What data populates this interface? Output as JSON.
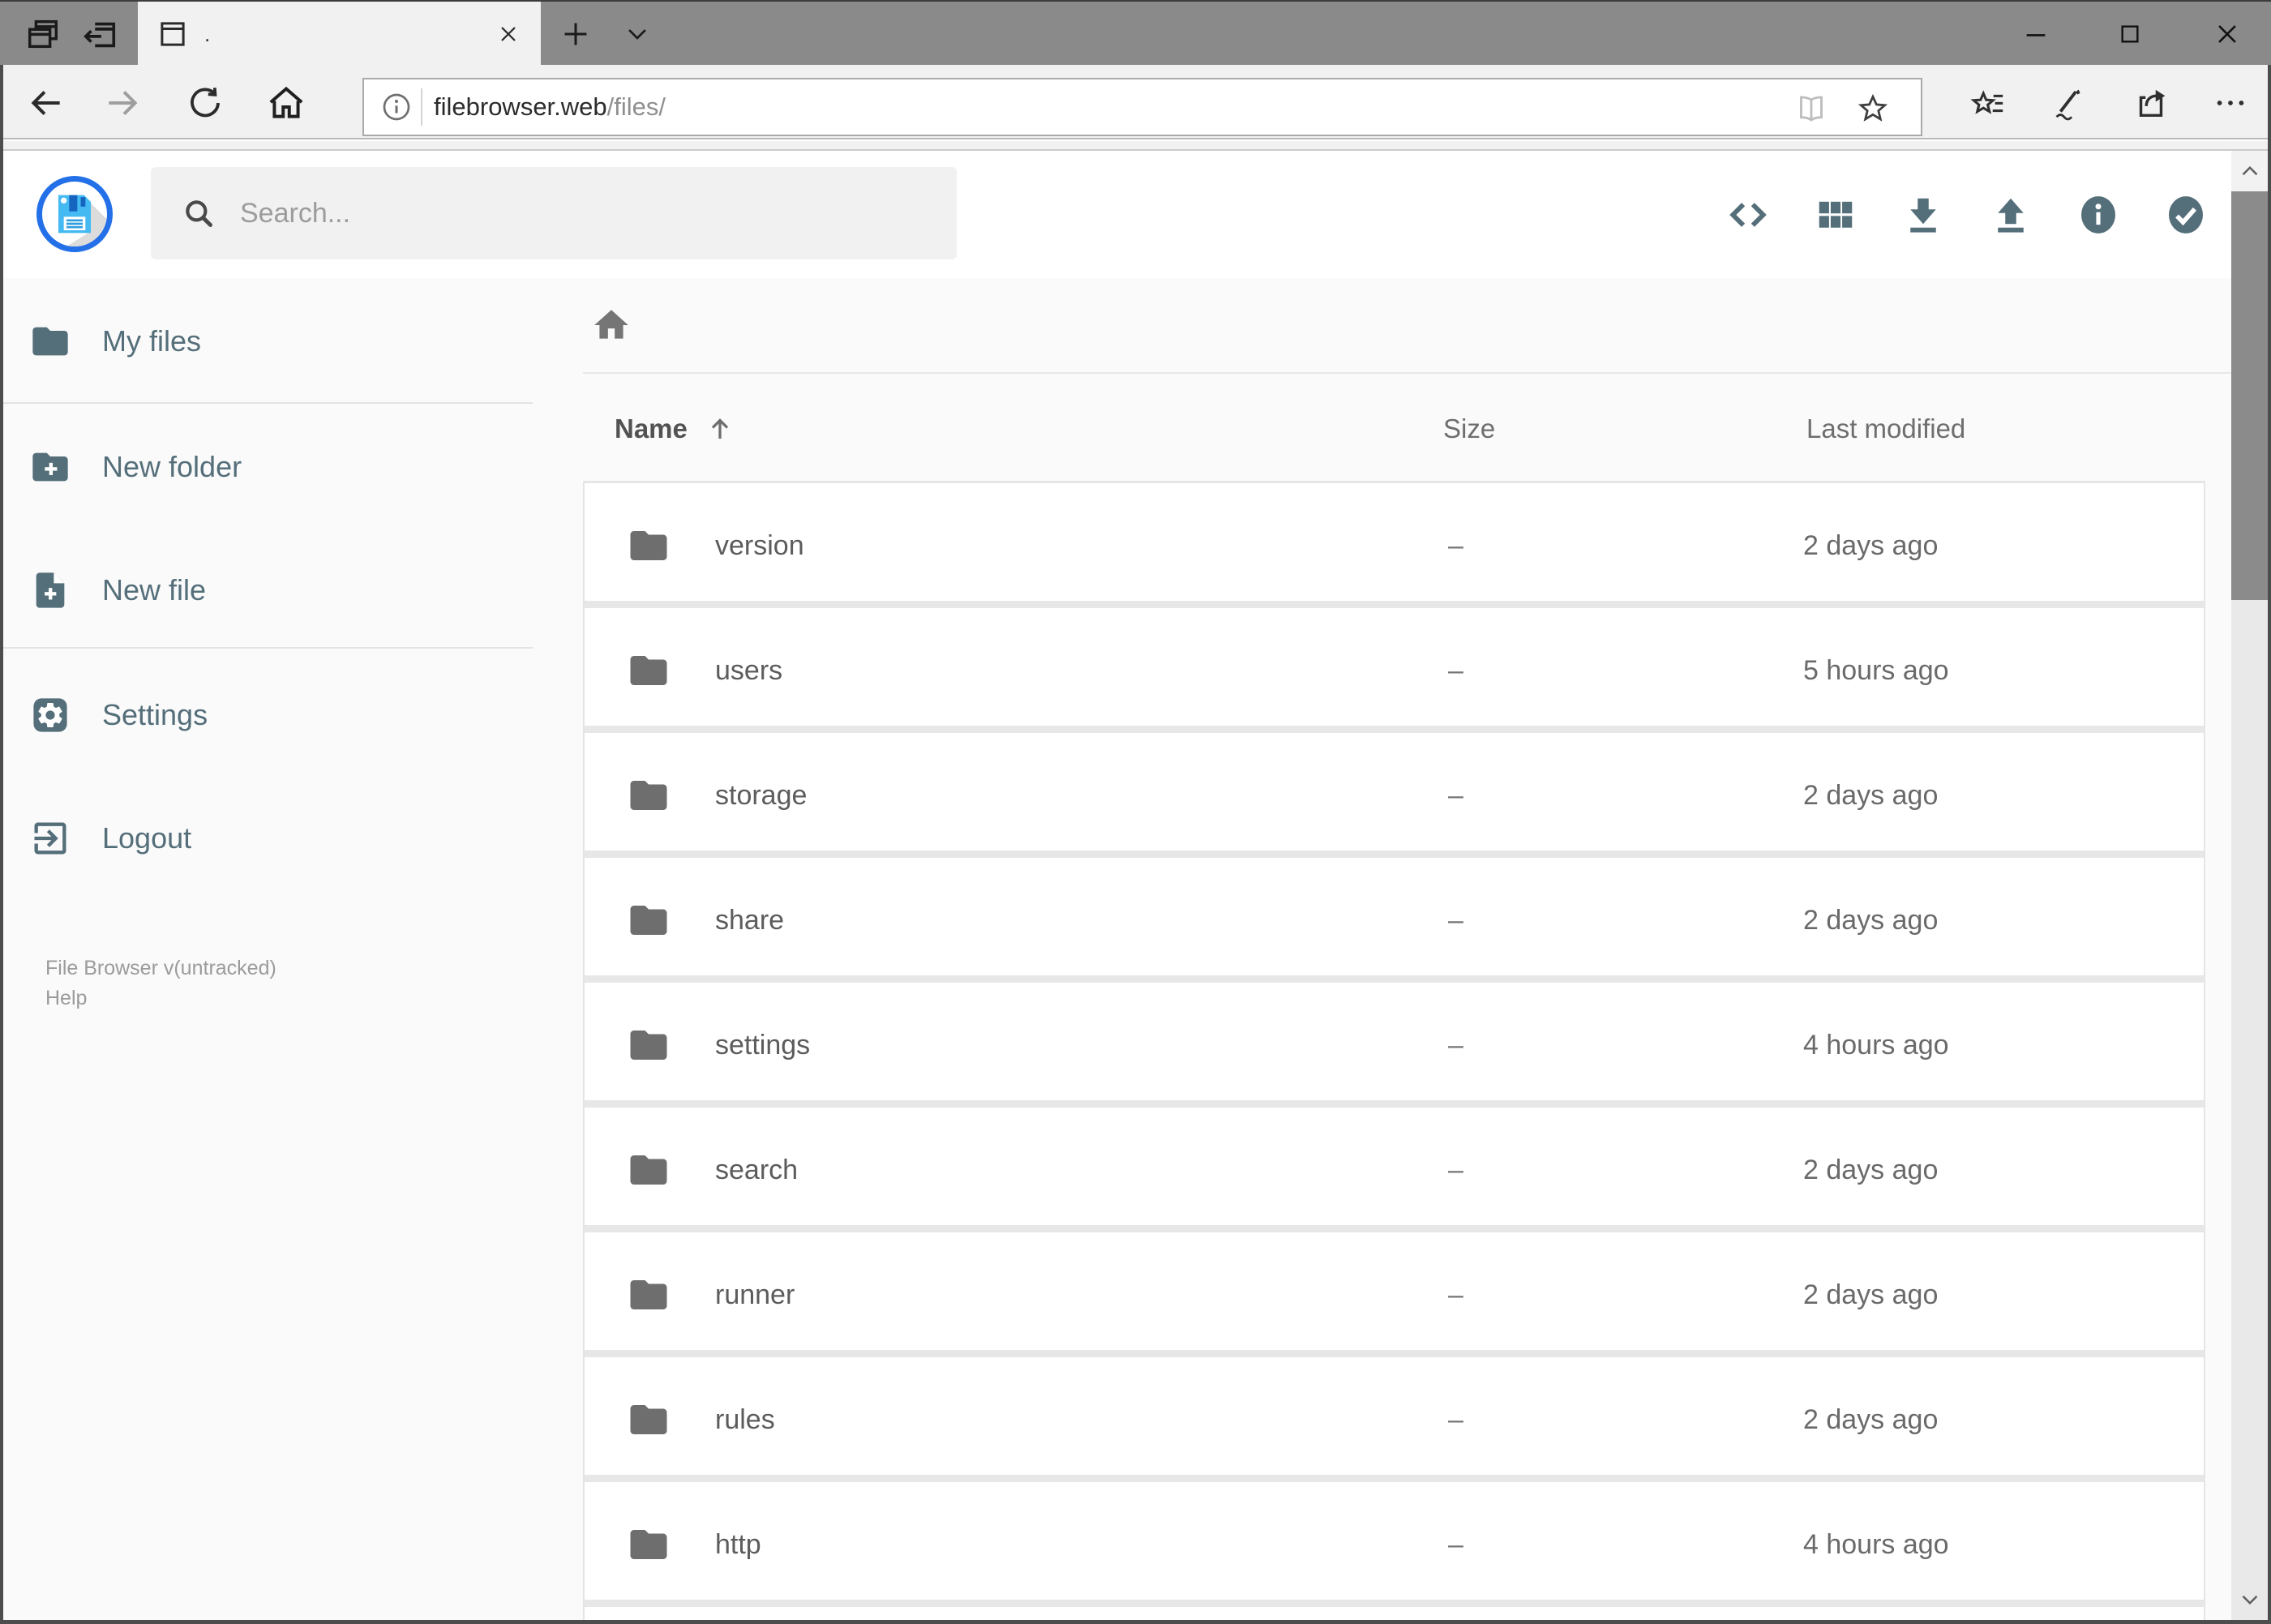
{
  "browser": {
    "tab_bar": {
      "active_tab": {
        "title": "."
      },
      "icons": [
        "tab-preview",
        "set-tabs-aside",
        "new-tab",
        "tab-list-chevron"
      ]
    },
    "window_controls": [
      "minimize",
      "maximize",
      "close"
    ],
    "nav": {
      "url_host": "filebrowser.web",
      "url_path": "/files/",
      "icons": [
        "back",
        "forward",
        "refresh",
        "home",
        "page-info",
        "reading-view",
        "favorite-star",
        "hub",
        "annotate",
        "share",
        "more"
      ]
    }
  },
  "app": {
    "search": {
      "placeholder": "Search..."
    },
    "header_actions": [
      "code",
      "grid-view",
      "download",
      "upload",
      "info",
      "select"
    ],
    "sidebar": {
      "items": [
        {
          "label": "My files",
          "icon": "folder"
        },
        {
          "label": "New folder",
          "icon": "folder-plus"
        },
        {
          "label": "New file",
          "icon": "file-plus"
        },
        {
          "label": "Settings",
          "icon": "gear"
        },
        {
          "label": "Logout",
          "icon": "logout"
        }
      ],
      "footer": {
        "version": "File Browser v(untracked)",
        "help": "Help"
      }
    },
    "breadcrumb": {
      "icon": "home"
    },
    "listing": {
      "columns": {
        "name": "Name",
        "size": "Size",
        "modified": "Last modified"
      },
      "sort": {
        "column": "Name",
        "direction": "asc"
      },
      "rows": [
        {
          "name": "version",
          "size": "–",
          "modified": "2 days ago"
        },
        {
          "name": "users",
          "size": "–",
          "modified": "5 hours ago"
        },
        {
          "name": "storage",
          "size": "–",
          "modified": "2 days ago"
        },
        {
          "name": "share",
          "size": "–",
          "modified": "2 days ago"
        },
        {
          "name": "settings",
          "size": "–",
          "modified": "4 hours ago"
        },
        {
          "name": "search",
          "size": "–",
          "modified": "2 days ago"
        },
        {
          "name": "runner",
          "size": "–",
          "modified": "2 days ago"
        },
        {
          "name": "rules",
          "size": "–",
          "modified": "2 days ago"
        },
        {
          "name": "http",
          "size": "–",
          "modified": "4 hours ago"
        }
      ]
    },
    "colors": {
      "accent_blue": "#2470e8",
      "slate": "#546e7a"
    }
  }
}
